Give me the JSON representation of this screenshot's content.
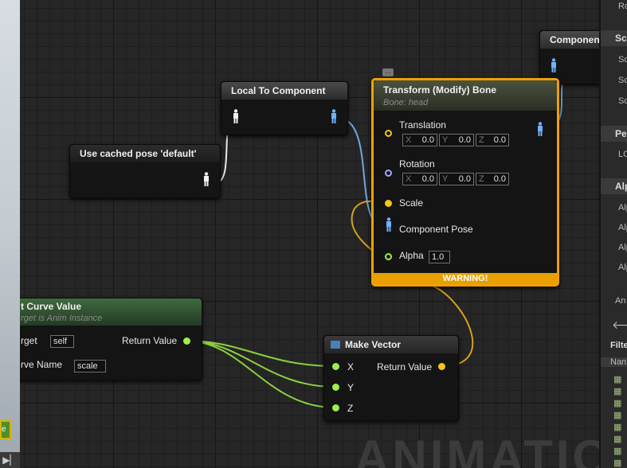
{
  "nodes": {
    "component_partial": {
      "title": "Componen"
    },
    "local_to_component": {
      "title": "Local To Component"
    },
    "cached_pose": {
      "title": "Use cached pose 'default'"
    },
    "transform_bone": {
      "title": "Transform (Modify) Bone",
      "subtitle": "Bone: head",
      "translation_label": "Translation",
      "rotation_label": "Rotation",
      "translation": {
        "x": "0.0",
        "y": "0.0",
        "z": "0.0"
      },
      "rotation": {
        "x": "0.0",
        "y": "0.0",
        "z": "0.0"
      },
      "axis_x": "X",
      "axis_y": "Y",
      "axis_z": "Z",
      "scale_label": "Scale",
      "component_pose_label": "Component Pose",
      "alpha_label": "Alpha",
      "alpha_value": "1.0",
      "warning": "WARNING!"
    },
    "get_curve": {
      "title": "t Curve Value",
      "subtitle": "rget is Anim Instance",
      "target_label": "rget",
      "target_value": "self",
      "curve_name_label": "rve Name",
      "curve_name_value": "scale",
      "return_label": "Return Value"
    },
    "make_vector": {
      "title": "Make Vector",
      "x": "X",
      "y": "Y",
      "z": "Z",
      "return_label": "Return Value"
    }
  },
  "watermark": "ANIMATION",
  "left_strip": {
    "badge": "e",
    "bottom_icon": "▶▏"
  },
  "right_panel": {
    "items": [
      "Ro",
      "Sc",
      "Sc",
      "Sc",
      "Sc",
      "Pe",
      "LC",
      "Alp",
      "Alp",
      "Alp",
      "Alp",
      "Alp",
      "An",
      "Filte",
      "Nan"
    ],
    "arrow": "🡐"
  },
  "colors": {
    "exec_pose": "#4a9eff",
    "float_pin": "#9cf048",
    "vector_pin": "#f5c518",
    "rotator_pin": "#a0a8ff",
    "selection": "#f0a000"
  }
}
